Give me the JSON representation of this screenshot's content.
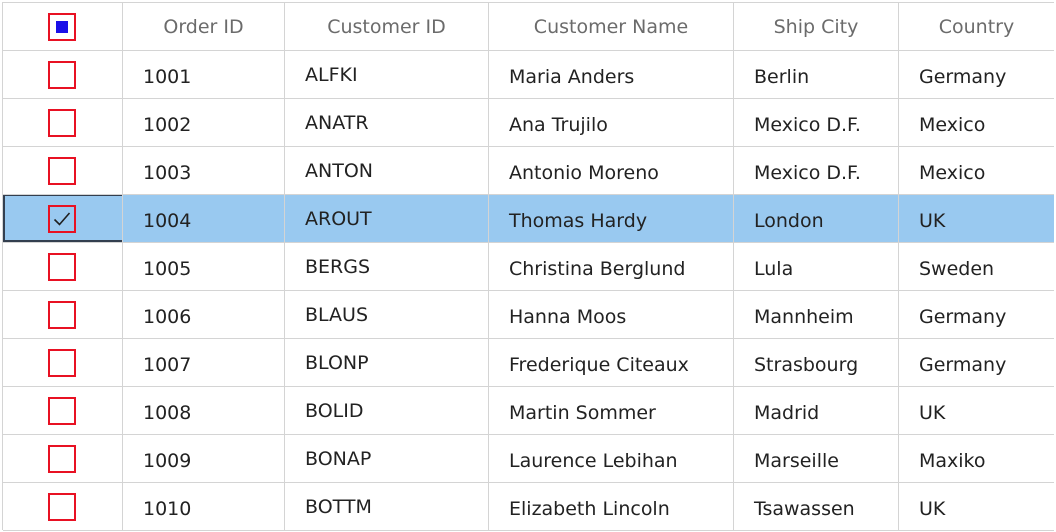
{
  "columns": [
    "Order ID",
    "Customer ID",
    "Customer Name",
    "Ship City",
    "Country"
  ],
  "header_checkbox": "indeterminate",
  "rows": [
    {
      "order_id": "1001",
      "customer_id": "ALFKI",
      "customer_name": "Maria Anders",
      "ship_city": "Berlin",
      "country": "Germany",
      "checked": false
    },
    {
      "order_id": "1002",
      "customer_id": "ANATR",
      "customer_name": "Ana Trujilo",
      "ship_city": "Mexico D.F.",
      "country": "Mexico",
      "checked": false
    },
    {
      "order_id": "1003",
      "customer_id": "ANTON",
      "customer_name": "Antonio Moreno",
      "ship_city": "Mexico D.F.",
      "country": "Mexico",
      "checked": false
    },
    {
      "order_id": "1004",
      "customer_id": "AROUT",
      "customer_name": "Thomas Hardy",
      "ship_city": "London",
      "country": "UK",
      "checked": true
    },
    {
      "order_id": "1005",
      "customer_id": "BERGS",
      "customer_name": "Christina Berglund",
      "ship_city": "Lula",
      "country": "Sweden",
      "checked": false
    },
    {
      "order_id": "1006",
      "customer_id": "BLAUS",
      "customer_name": "Hanna Moos",
      "ship_city": "Mannheim",
      "country": "Germany",
      "checked": false
    },
    {
      "order_id": "1007",
      "customer_id": "BLONP",
      "customer_name": "Frederique Citeaux",
      "ship_city": "Strasbourg",
      "country": "Germany",
      "checked": false
    },
    {
      "order_id": "1008",
      "customer_id": "BOLID",
      "customer_name": "Martin Sommer",
      "ship_city": "Madrid",
      "country": "UK",
      "checked": false
    },
    {
      "order_id": "1009",
      "customer_id": "BONAP",
      "customer_name": "Laurence Lebihan",
      "ship_city": "Marseille",
      "country": "Maxiko",
      "checked": false
    },
    {
      "order_id": "1010",
      "customer_id": "BOTTM",
      "customer_name": "Elizabeth Lincoln",
      "ship_city": "Tsawassen",
      "country": "UK",
      "checked": false
    }
  ],
  "colors": {
    "selected_row": "#99c9f0",
    "checkbox_border": "#e81123",
    "indeterminate_fill": "#1a10e8",
    "gridline": "#d4d4d4"
  }
}
